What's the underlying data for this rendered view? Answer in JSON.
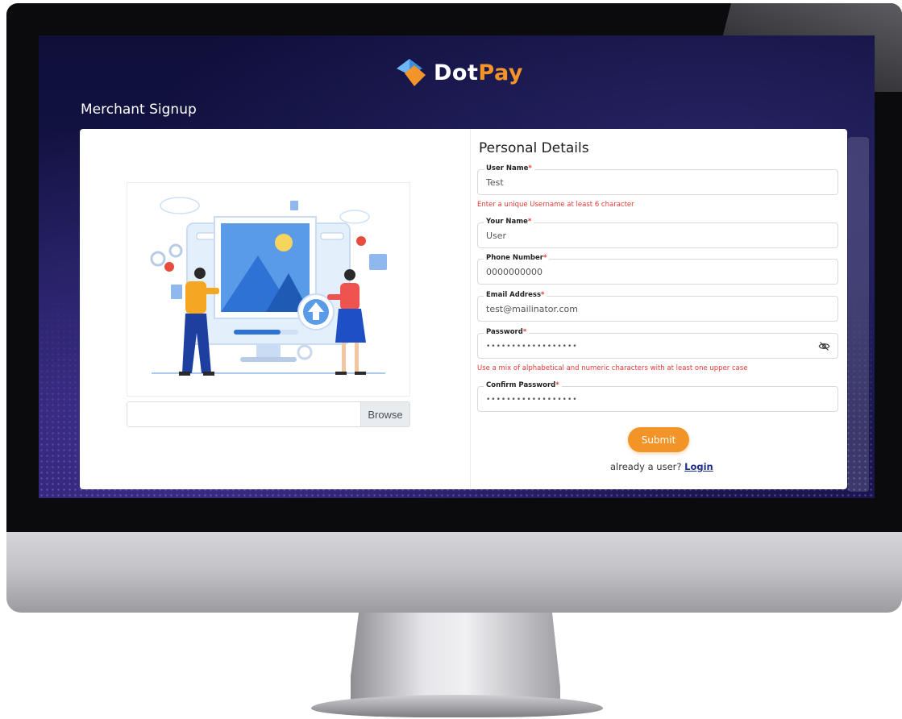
{
  "brand": {
    "name_part1": "Dot",
    "name_part2": "Pay"
  },
  "page": {
    "title": "Merchant Signup"
  },
  "upload": {
    "browse_label": "Browse"
  },
  "form": {
    "title": "Personal Details",
    "required_mark": "*",
    "fields": {
      "username": {
        "label": "User Name",
        "value": "Test"
      },
      "your_name": {
        "label": "Your Name",
        "value": "User"
      },
      "phone": {
        "label": "Phone Number",
        "value": "0000000000"
      },
      "email": {
        "label": "Email Address",
        "value": "test@mailinator.com"
      },
      "password": {
        "label": "Password",
        "value": "••••••••••••••••••"
      },
      "confirm_password": {
        "label": "Confirm Password",
        "value": "••••••••••••••••••"
      }
    },
    "hints": {
      "username": "Enter a unique Username at least 6 character",
      "password": "Use a mix of alphabetical and numeric characters with at least one upper case"
    },
    "submit_label": "Submit",
    "login_prompt": "already a user?",
    "login_link": "Login"
  },
  "colors": {
    "accent": "#f29427",
    "screen_bg": "#16164a",
    "error": "#e53935",
    "link": "#1f2f8c"
  },
  "icons": [
    "dotpay-logo-icon",
    "eye-off-icon",
    "upload-illustration-icon"
  ]
}
